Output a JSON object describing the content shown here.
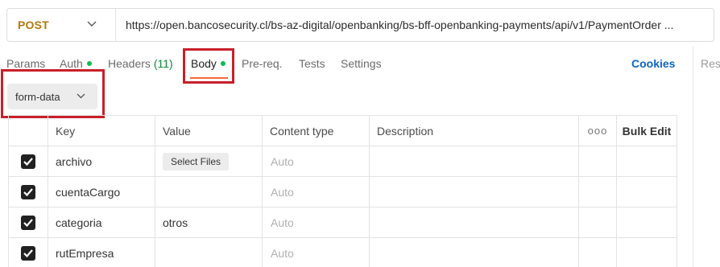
{
  "request": {
    "method": "POST",
    "url": "https://open.bancosecurity.cl/bs-az-digital/openbanking/bs-bff-openbanking-payments/api/v1/PaymentOrder ..."
  },
  "tabs": [
    {
      "label": "Params"
    },
    {
      "label": "Auth"
    },
    {
      "label": "Headers",
      "count": "(11)"
    },
    {
      "label": "Body"
    },
    {
      "label": "Pre-req."
    },
    {
      "label": "Tests"
    },
    {
      "label": "Settings"
    }
  ],
  "cookies_label": "Cookies",
  "response_label": "Res",
  "body_type": "form-data",
  "table": {
    "headers": {
      "key": "Key",
      "value": "Value",
      "content_type": "Content type",
      "description": "Description",
      "more": "ooo",
      "bulk_edit": "Bulk Edit"
    },
    "rows": [
      {
        "checked": true,
        "key": "archivo",
        "value": "",
        "value_button": "Select Files",
        "content_type": "Auto",
        "description": ""
      },
      {
        "checked": true,
        "key": "cuentaCargo",
        "value": "",
        "content_type": "Auto",
        "description": ""
      },
      {
        "checked": true,
        "key": "categoria",
        "value": "otros",
        "content_type": "Auto",
        "description": ""
      },
      {
        "checked": true,
        "key": "rutEmpresa",
        "value": "",
        "content_type": "Auto",
        "description": ""
      }
    ]
  },
  "colors": {
    "method": "#b07a0c",
    "active_tab_underline": "#f26b3a",
    "status_dot": "#0cbb52",
    "cookies_link": "#0b66c2",
    "highlight": "#c8202a"
  }
}
